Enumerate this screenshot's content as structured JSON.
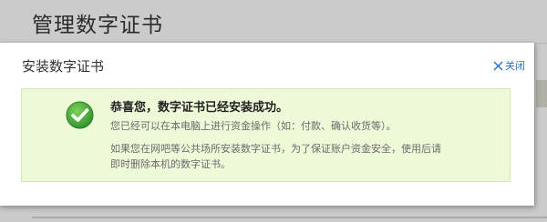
{
  "background": {
    "page_title": "管理数字证书"
  },
  "dialog": {
    "title": "安装数字证书",
    "close_label": "关闭",
    "message": {
      "title": "恭喜您，数字证书已经安装成功。",
      "line1": "您已经可以在本电脑上进行资金操作（如：付款、确认收货等）。",
      "line2": "如果您在网吧等公共场所安装数字证书，为了保证账户资金安全，使用后请",
      "line3": "即时删除本机的数字证书。"
    }
  },
  "colors": {
    "accent_link": "#2c6ec4",
    "success_bg": "#eef9d8",
    "success_border": "#d4e7b0",
    "check_green": "#3ea53a"
  },
  "icons": {
    "close": "close-icon",
    "success": "check-circle-icon"
  }
}
